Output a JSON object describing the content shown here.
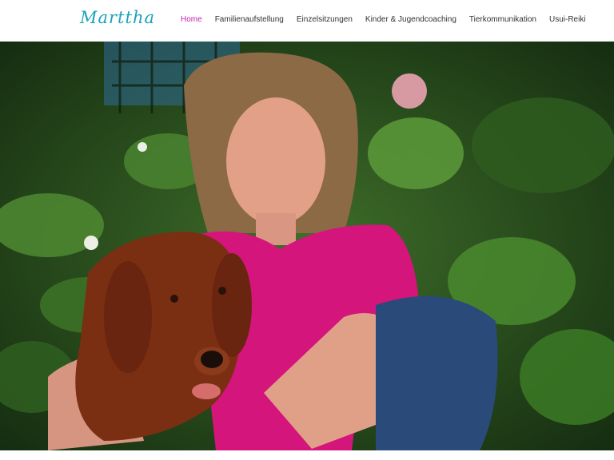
{
  "brand": {
    "logo_text": "Marttha"
  },
  "nav": {
    "items": [
      {
        "label": "Home",
        "active": true
      },
      {
        "label": "Familienaufstellung",
        "active": false
      },
      {
        "label": "Einzelsitzungen",
        "active": false
      },
      {
        "label": "Kinder & Jugendcoaching",
        "active": false
      },
      {
        "label": "Tierkommunikation",
        "active": false
      },
      {
        "label": "Usui-Reiki",
        "active": false
      }
    ]
  },
  "colors": {
    "brand": "#1aa3b8",
    "nav_active": "#c81fb3",
    "nav_text": "#333333"
  },
  "hero": {
    "subject": "photo-woman-with-irish-setter-in-garden"
  }
}
